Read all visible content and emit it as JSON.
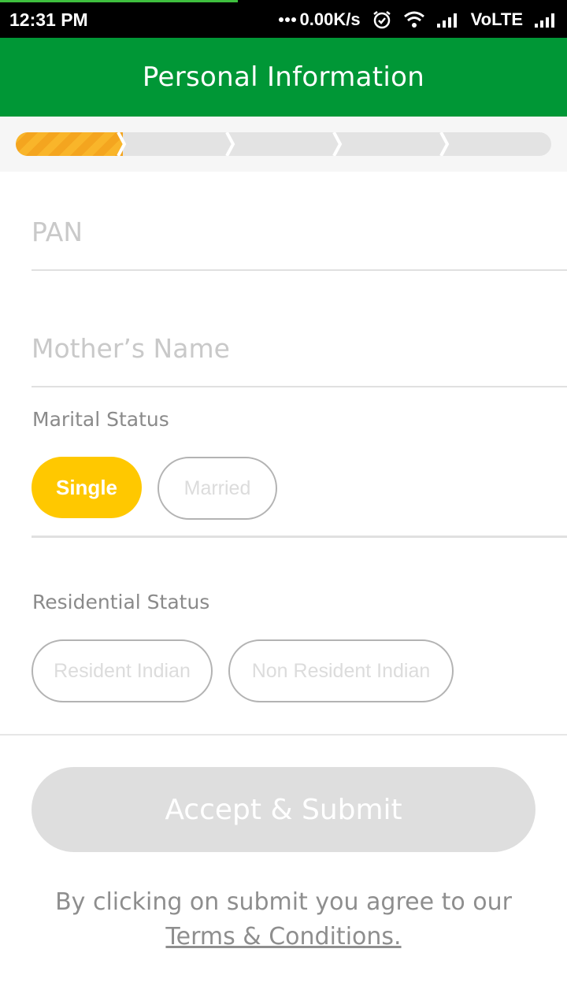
{
  "status_bar": {
    "time": "12:31 PM",
    "network_speed": "0.00K/s",
    "network": "VoLTE",
    "icons": [
      "more-dots-icon",
      "alarm-icon",
      "wifi-icon",
      "signal-icon",
      "signal-icon-2"
    ]
  },
  "header": {
    "title": "Personal Information"
  },
  "stepper": {
    "total_steps": 5,
    "current_step": 1,
    "accent_color": "#f7ae24"
  },
  "form": {
    "pan": {
      "placeholder": "PAN",
      "value": ""
    },
    "mothers_name": {
      "placeholder": "Mother’s Name",
      "value": ""
    },
    "marital_status": {
      "label": "Marital Status",
      "options": [
        "Single",
        "Married"
      ],
      "selected": "Single"
    },
    "residential_status": {
      "label": "Residential Status",
      "options": [
        "Resident Indian",
        "Non Resident Indian"
      ],
      "selected": ""
    }
  },
  "submit": {
    "label": "Accept & Submit"
  },
  "terms": {
    "text": "By clicking on submit you agree to our",
    "link": "Terms & Conditions."
  },
  "colors": {
    "header": "#009736",
    "selected_pill": "#ffc800",
    "disabled_button": "#dedede"
  }
}
